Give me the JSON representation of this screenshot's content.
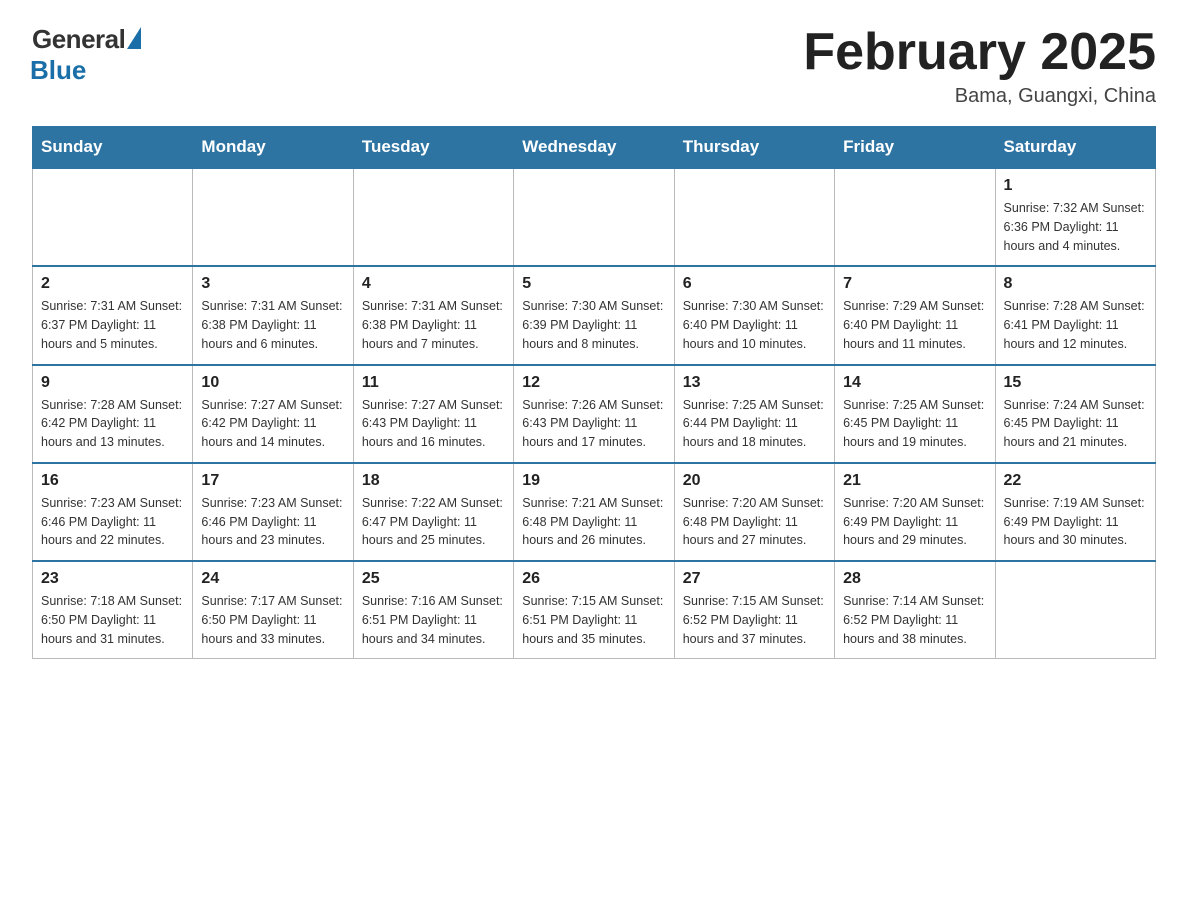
{
  "header": {
    "logo_general": "General",
    "logo_blue": "Blue",
    "month_title": "February 2025",
    "location": "Bama, Guangxi, China"
  },
  "days_of_week": [
    "Sunday",
    "Monday",
    "Tuesday",
    "Wednesday",
    "Thursday",
    "Friday",
    "Saturday"
  ],
  "weeks": [
    [
      {
        "day": "",
        "info": ""
      },
      {
        "day": "",
        "info": ""
      },
      {
        "day": "",
        "info": ""
      },
      {
        "day": "",
        "info": ""
      },
      {
        "day": "",
        "info": ""
      },
      {
        "day": "",
        "info": ""
      },
      {
        "day": "1",
        "info": "Sunrise: 7:32 AM\nSunset: 6:36 PM\nDaylight: 11 hours and 4 minutes."
      }
    ],
    [
      {
        "day": "2",
        "info": "Sunrise: 7:31 AM\nSunset: 6:37 PM\nDaylight: 11 hours and 5 minutes."
      },
      {
        "day": "3",
        "info": "Sunrise: 7:31 AM\nSunset: 6:38 PM\nDaylight: 11 hours and 6 minutes."
      },
      {
        "day": "4",
        "info": "Sunrise: 7:31 AM\nSunset: 6:38 PM\nDaylight: 11 hours and 7 minutes."
      },
      {
        "day": "5",
        "info": "Sunrise: 7:30 AM\nSunset: 6:39 PM\nDaylight: 11 hours and 8 minutes."
      },
      {
        "day": "6",
        "info": "Sunrise: 7:30 AM\nSunset: 6:40 PM\nDaylight: 11 hours and 10 minutes."
      },
      {
        "day": "7",
        "info": "Sunrise: 7:29 AM\nSunset: 6:40 PM\nDaylight: 11 hours and 11 minutes."
      },
      {
        "day": "8",
        "info": "Sunrise: 7:28 AM\nSunset: 6:41 PM\nDaylight: 11 hours and 12 minutes."
      }
    ],
    [
      {
        "day": "9",
        "info": "Sunrise: 7:28 AM\nSunset: 6:42 PM\nDaylight: 11 hours and 13 minutes."
      },
      {
        "day": "10",
        "info": "Sunrise: 7:27 AM\nSunset: 6:42 PM\nDaylight: 11 hours and 14 minutes."
      },
      {
        "day": "11",
        "info": "Sunrise: 7:27 AM\nSunset: 6:43 PM\nDaylight: 11 hours and 16 minutes."
      },
      {
        "day": "12",
        "info": "Sunrise: 7:26 AM\nSunset: 6:43 PM\nDaylight: 11 hours and 17 minutes."
      },
      {
        "day": "13",
        "info": "Sunrise: 7:25 AM\nSunset: 6:44 PM\nDaylight: 11 hours and 18 minutes."
      },
      {
        "day": "14",
        "info": "Sunrise: 7:25 AM\nSunset: 6:45 PM\nDaylight: 11 hours and 19 minutes."
      },
      {
        "day": "15",
        "info": "Sunrise: 7:24 AM\nSunset: 6:45 PM\nDaylight: 11 hours and 21 minutes."
      }
    ],
    [
      {
        "day": "16",
        "info": "Sunrise: 7:23 AM\nSunset: 6:46 PM\nDaylight: 11 hours and 22 minutes."
      },
      {
        "day": "17",
        "info": "Sunrise: 7:23 AM\nSunset: 6:46 PM\nDaylight: 11 hours and 23 minutes."
      },
      {
        "day": "18",
        "info": "Sunrise: 7:22 AM\nSunset: 6:47 PM\nDaylight: 11 hours and 25 minutes."
      },
      {
        "day": "19",
        "info": "Sunrise: 7:21 AM\nSunset: 6:48 PM\nDaylight: 11 hours and 26 minutes."
      },
      {
        "day": "20",
        "info": "Sunrise: 7:20 AM\nSunset: 6:48 PM\nDaylight: 11 hours and 27 minutes."
      },
      {
        "day": "21",
        "info": "Sunrise: 7:20 AM\nSunset: 6:49 PM\nDaylight: 11 hours and 29 minutes."
      },
      {
        "day": "22",
        "info": "Sunrise: 7:19 AM\nSunset: 6:49 PM\nDaylight: 11 hours and 30 minutes."
      }
    ],
    [
      {
        "day": "23",
        "info": "Sunrise: 7:18 AM\nSunset: 6:50 PM\nDaylight: 11 hours and 31 minutes."
      },
      {
        "day": "24",
        "info": "Sunrise: 7:17 AM\nSunset: 6:50 PM\nDaylight: 11 hours and 33 minutes."
      },
      {
        "day": "25",
        "info": "Sunrise: 7:16 AM\nSunset: 6:51 PM\nDaylight: 11 hours and 34 minutes."
      },
      {
        "day": "26",
        "info": "Sunrise: 7:15 AM\nSunset: 6:51 PM\nDaylight: 11 hours and 35 minutes."
      },
      {
        "day": "27",
        "info": "Sunrise: 7:15 AM\nSunset: 6:52 PM\nDaylight: 11 hours and 37 minutes."
      },
      {
        "day": "28",
        "info": "Sunrise: 7:14 AM\nSunset: 6:52 PM\nDaylight: 11 hours and 38 minutes."
      },
      {
        "day": "",
        "info": ""
      }
    ]
  ]
}
